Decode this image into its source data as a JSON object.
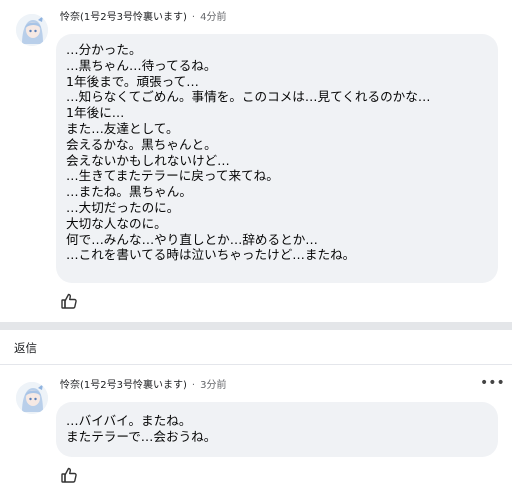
{
  "comments": [
    {
      "author": "怜奈(1号2号3号怜裏います)",
      "time": "4分前",
      "lines": [
        "…分かった。",
        "…黒ちゃん…待ってるね。",
        "1年後まで。頑張って…",
        "…知らなくてごめん。事情を。このコメは…見てくれるのかな…",
        "1年後に…",
        "また…友達として。",
        "会えるかな。黒ちゃんと。",
        "会えないかもしれないけど…",
        "…生きてまたテラーに戻って来てね。",
        "…またね。黒ちゃん。",
        "…大切だったのに。",
        "大切な人なのに。",
        "何で…みんな…やり直しとか…辞めるとか…",
        "…これを書いてる時は泣いちゃったけど…またね。"
      ]
    },
    {
      "author": "怜奈(1号2号3号怜裏います)",
      "time": "3分前",
      "lines": [
        "…バイバイ。またね。",
        "またテラーで…会おうね。"
      ]
    }
  ],
  "reply_label": "返信",
  "meta_separator": "·",
  "more_label": "•••",
  "icons": {
    "like": "thumbs-up-icon",
    "more": "more-options-icon",
    "avatar": "avatar-illustration"
  },
  "colors": {
    "bubble_bg": "#f0f2f5",
    "meta_text": "#65676b",
    "divider": "#e4e6e9"
  }
}
